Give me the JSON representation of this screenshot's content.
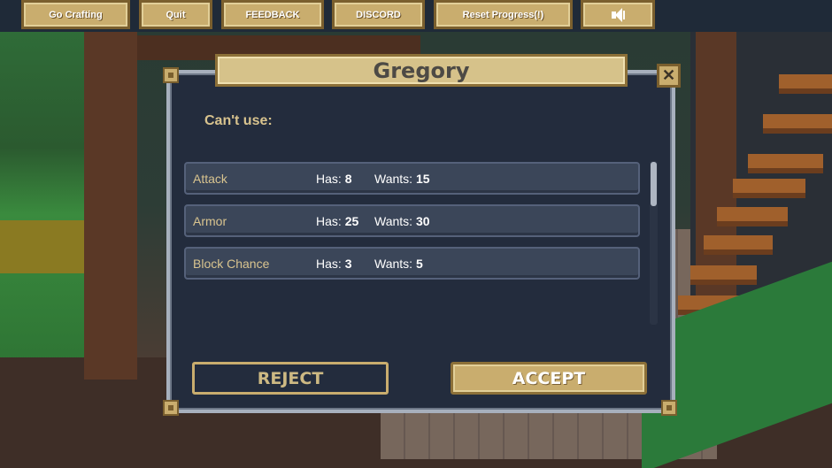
{
  "topbar": {
    "go_crafting": "Go Crafting",
    "quit": "Quit",
    "feedback": "FEEDBACK",
    "discord": "DISCORD",
    "reset_progress": "Reset Progress(!)",
    "sound_icon": "speaker-icon"
  },
  "dialog": {
    "title": "Gregory",
    "close_icon": "close-icon",
    "cant_use_label": "Can't use:",
    "has_label": "Has:",
    "wants_label": "Wants:",
    "rows": [
      {
        "stat": "Attack",
        "has": "8",
        "wants": "15"
      },
      {
        "stat": "Armor",
        "has": "25",
        "wants": "30"
      },
      {
        "stat": "Block Chance",
        "has": "3",
        "wants": "5"
      }
    ],
    "reject_label": "REJECT",
    "accept_label": "ACCEPT"
  },
  "colors": {
    "gold": "#c9ad6e",
    "panel": "#232c3d",
    "row": "#3b4659",
    "stat_text": "#d9c48f"
  }
}
